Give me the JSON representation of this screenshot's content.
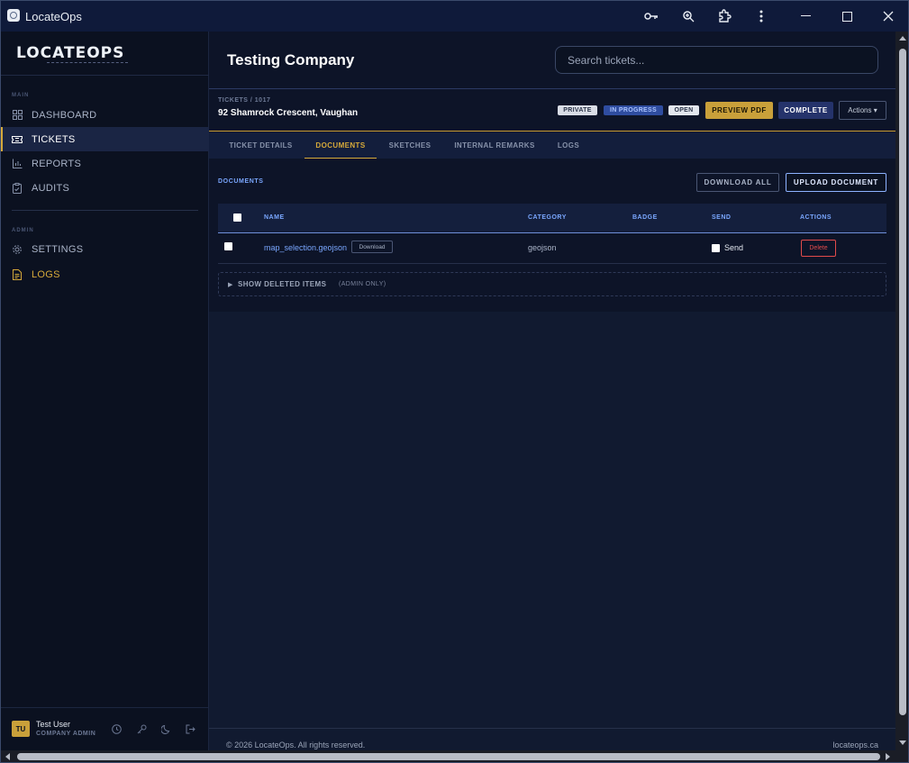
{
  "window": {
    "title": "LocateOps"
  },
  "titlebar_icons": [
    "key-icon",
    "zoom-icon",
    "extension-icon",
    "more-icon"
  ],
  "sidebar": {
    "logo": "LOCATEOPS",
    "main_label": "MAIN",
    "admin_label": "ADMIN",
    "items": [
      {
        "label": "DASHBOARD",
        "icon": "dashboard-icon"
      },
      {
        "label": "TICKETS",
        "icon": "ticket-icon"
      },
      {
        "label": "REPORTS",
        "icon": "bar-chart-icon"
      },
      {
        "label": "AUDITS",
        "icon": "clipboard-icon"
      }
    ],
    "admin_items": [
      {
        "label": "SETTINGS",
        "icon": "gear-icon"
      },
      {
        "label": "LOGS",
        "icon": "document-icon"
      }
    ],
    "user": {
      "initials": "TU",
      "name": "Test User",
      "role": "COMPANY ADMIN"
    }
  },
  "header": {
    "company": "Testing Company",
    "search_placeholder": "Search tickets..."
  },
  "ticket": {
    "breadcrumb": "TICKETS / 1017",
    "address": "92 Shamrock Crescent, Vaughan",
    "badges": {
      "private": "PRIVATE",
      "in_progress": "IN PROGRESS",
      "open": "OPEN"
    },
    "preview_pdf": "PREVIEW PDF",
    "complete": "COMPLETE",
    "actions": "Actions ▾"
  },
  "tabs": [
    {
      "label": "TICKET DETAILS",
      "active": false
    },
    {
      "label": "DOCUMENTS",
      "active": true
    },
    {
      "label": "SKETCHES",
      "active": false
    },
    {
      "label": "INTERNAL REMARKS",
      "active": false
    },
    {
      "label": "LOGS",
      "active": false
    }
  ],
  "documents": {
    "label": "DOCUMENTS",
    "download_all": "DOWNLOAD ALL",
    "upload": "UPLOAD DOCUMENT",
    "columns": {
      "name": "NAME",
      "category": "CATEGORY",
      "badge": "BADGE",
      "send": "SEND",
      "actions": "ACTIONS"
    },
    "rows": [
      {
        "name": "map_selection.geojson",
        "download": "Download",
        "category": "geojson",
        "badge": "",
        "send_label": "Send",
        "delete": "Delete"
      }
    ],
    "deleted_title": "SHOW DELETED ITEMS",
    "deleted_note": "(ADMIN ONLY)"
  },
  "footer": {
    "copyright": "© 2026 LocateOps. All rights reserved.",
    "site": "locateops.ca"
  },
  "colors": {
    "accent_gold": "#d6a93a",
    "link_blue": "#7aa7ff",
    "danger": "#e24b4b",
    "background": "#0d1426"
  }
}
